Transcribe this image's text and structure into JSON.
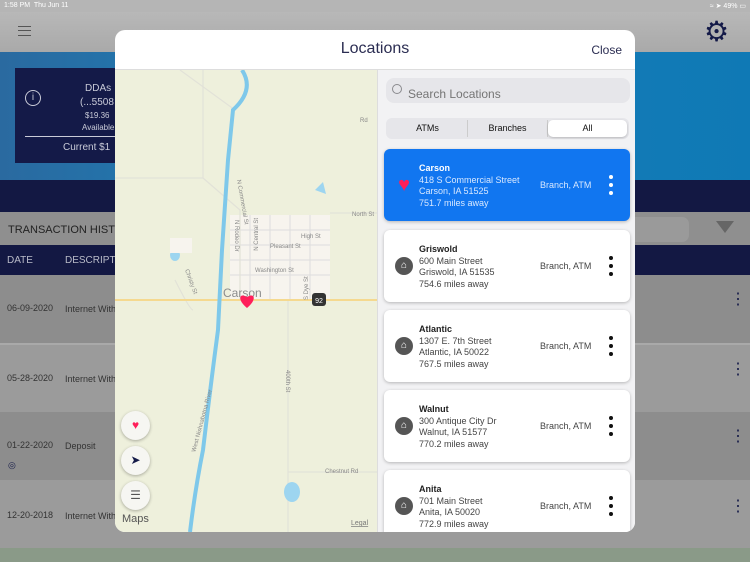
{
  "status": {
    "time": "1:58 PM",
    "date": "Thu Jun 11",
    "battery": "49%"
  },
  "background": {
    "account": {
      "name": "DDAs",
      "number": "(...5508",
      "balance": "$19.36",
      "available": "Available",
      "current": "Current $1"
    },
    "section_title": "TRANSACTION HISTORY",
    "columns": [
      "DATE",
      "DESCRIPTION"
    ],
    "rows": [
      {
        "date": "06-09-2020",
        "desc": "Internet Withdrawal"
      },
      {
        "date": "05-28-2020",
        "desc": "Internet Withdrawal"
      },
      {
        "date": "01-22-2020",
        "desc": "Deposit"
      },
      {
        "date": "12-20-2018",
        "desc": "Internet Withdrawal"
      }
    ]
  },
  "modal": {
    "title": "Locations",
    "close_label": "Close",
    "search_placeholder": "Search Locations",
    "filters": [
      "ATMs",
      "Branches",
      "All"
    ],
    "selected_filter": "All",
    "locations": [
      {
        "name": "Carson",
        "street": "418 S Commercial Street",
        "city": "Carson, IA 51525",
        "distance": "751.7 miles away",
        "type": "Branch, ATM",
        "icon": "heart-icon",
        "selected": true
      },
      {
        "name": "Griswold",
        "street": "600 Main Street",
        "city": "Griswold, IA 51535",
        "distance": "754.6 miles away",
        "type": "Branch, ATM",
        "icon": "bank-icon"
      },
      {
        "name": "Atlantic",
        "street": "1307 E. 7th Street",
        "city": "Atlantic, IA 50022",
        "distance": "767.5 miles away",
        "type": "Branch, ATM",
        "icon": "bank-icon"
      },
      {
        "name": "Walnut",
        "street": "300 Antique City Dr",
        "city": "Walnut, IA 51577",
        "distance": "770.2 miles away",
        "type": "Branch, ATM",
        "icon": "bank-icon"
      },
      {
        "name": "Anita",
        "street": "701 Main Street",
        "city": "Anita, IA 50020",
        "distance": "772.9 miles away",
        "type": "Branch, ATM",
        "icon": "bank-icon"
      }
    ],
    "map": {
      "town": "Carson",
      "highway": "92",
      "attribution": "Maps",
      "legal": "Legal",
      "streets": [
        "North St",
        "High St",
        "Pleasant St",
        "Washington St",
        "N Commercial St",
        "N Rodeo Dr",
        "N Central St",
        "S Dye St",
        "Christy St",
        "400th St",
        "Chestnut Rd",
        "West Nishnabotna River",
        "Rd",
        "St"
      ]
    }
  },
  "colors": {
    "accent": "#1176f0",
    "favorite": "#ff1f5a",
    "navy": "#131843"
  }
}
